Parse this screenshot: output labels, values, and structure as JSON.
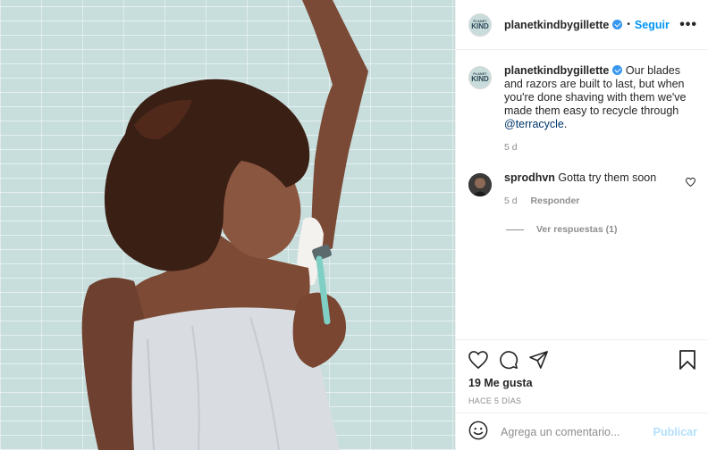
{
  "header": {
    "avatar_small": "PLANET",
    "avatar_big": "KIND",
    "username": "planetkindbygillette",
    "dot": "•",
    "follow_label": "Seguir",
    "more_label": "•••"
  },
  "caption": {
    "username": "planetkindbygillette",
    "text": " Our blades and razors are built to last, but when you're done shaving with them we've made them easy to recycle through ",
    "mention": "@terracycle",
    "suffix": ".",
    "time": "5 d"
  },
  "reply_comment": {
    "username": "sprodhvn",
    "text": " Gotta try them soon",
    "time": "5 d",
    "reply_label": "Responder",
    "view_replies": "Ver respuestas (1)"
  },
  "actions": {
    "likes": "19 Me gusta",
    "timestamp": "HACE 5 DÍAS"
  },
  "add_comment": {
    "placeholder": "Agrega un comentario...",
    "post_label": "Publicar"
  },
  "colors": {
    "accent": "#0095f6",
    "verified": "#3897f0",
    "publish_disabled": "#b2dffc",
    "muted": "#8e8e8e"
  }
}
